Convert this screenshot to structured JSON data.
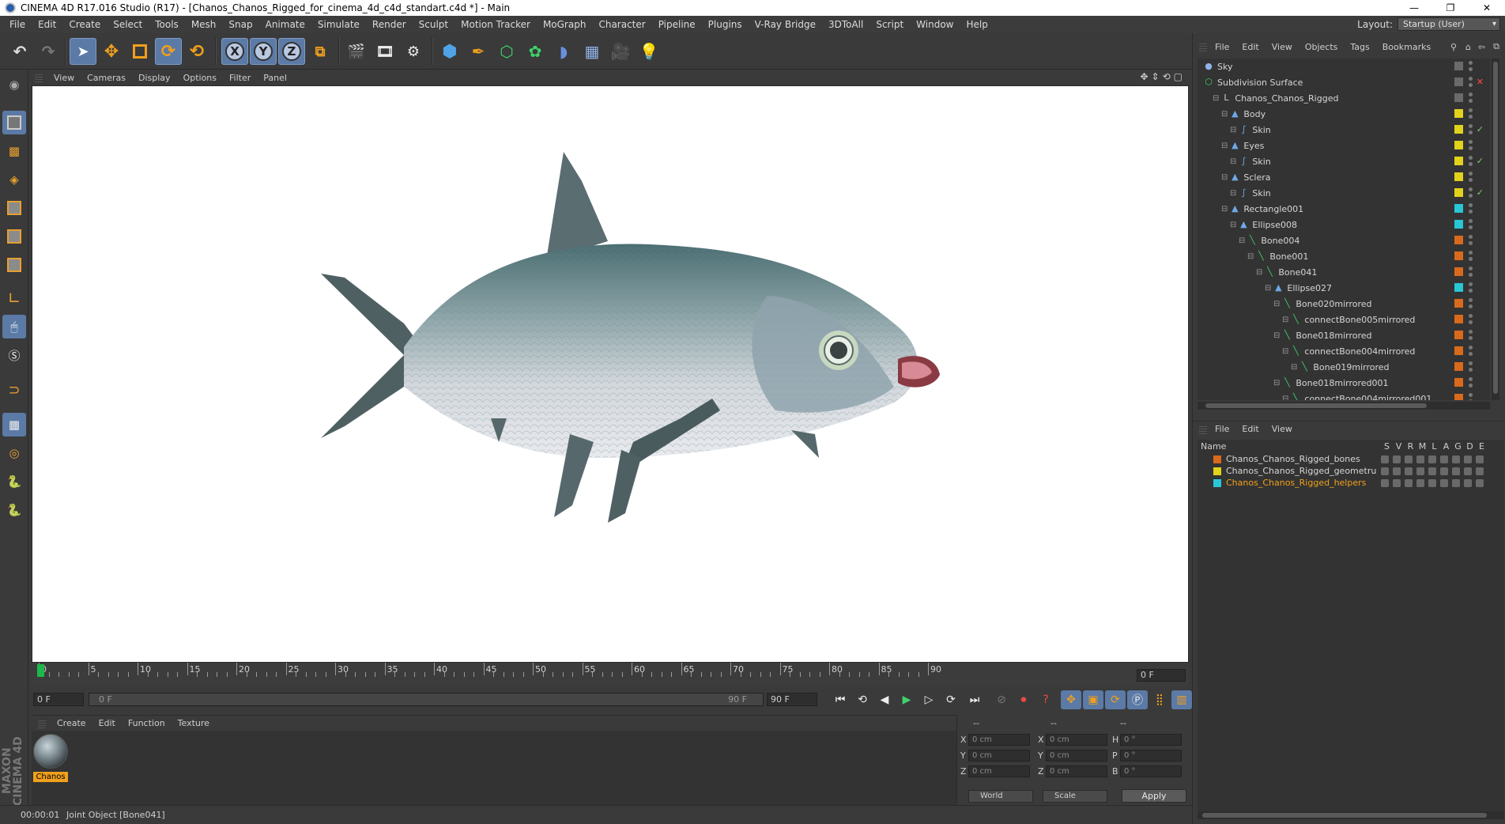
{
  "window": {
    "title": "CINEMA 4D R17.016 Studio (R17) - [Chanos_Chanos_Rigged_for_cinema_4d_c4d_standart.c4d *] - Main",
    "controls": [
      "—",
      "❐",
      "✕"
    ]
  },
  "menubar": {
    "items": [
      "File",
      "Edit",
      "Create",
      "Select",
      "Tools",
      "Mesh",
      "Snap",
      "Animate",
      "Simulate",
      "Render",
      "Sculpt",
      "Motion Tracker",
      "MoGraph",
      "Character",
      "Pipeline",
      "Plugins",
      "V-Ray Bridge",
      "3DToAll",
      "Script",
      "Window",
      "Help"
    ],
    "layout_label": "Layout:",
    "layout_value": "Startup (User)"
  },
  "toolbar": {
    "icons": [
      "undo-icon",
      "redo-icon",
      "select-arrow-icon",
      "move-icon",
      "scale-icon",
      "rotate-icon",
      "live-rotate-icon",
      "x-axis-icon",
      "y-axis-icon",
      "z-axis-icon",
      "coord-system-icon",
      "render-view-icon",
      "render-picture-viewer-icon",
      "render-settings-icon",
      "cube-icon",
      "pen-spline-icon",
      "subdivision-icon",
      "cloner-icon",
      "deformer-icon",
      "floor-icon",
      "camera-icon",
      "light-icon"
    ],
    "axis_labels": [
      "X",
      "Y",
      "Z"
    ]
  },
  "viewport": {
    "menu": [
      "View",
      "Cameras",
      "Display",
      "Options",
      "Filter",
      "Panel"
    ]
  },
  "timeline": {
    "ticks": [
      0,
      5,
      10,
      15,
      20,
      25,
      30,
      35,
      40,
      45,
      50,
      55,
      60,
      65,
      70,
      75,
      80,
      85,
      90
    ],
    "current_frame": 0,
    "end_frame_field": "0 F"
  },
  "transport": {
    "start_field": "0 F",
    "range_start": "0 F",
    "range_end": "90 F",
    "end_field": "90 F"
  },
  "material_manager": {
    "menu": [
      "Create",
      "Edit",
      "Function",
      "Texture"
    ],
    "material_name": "Chanos"
  },
  "coordinates": {
    "header": [
      "--",
      "--",
      "--"
    ],
    "rows": [
      {
        "l1": "X",
        "v1": "0 cm",
        "l2": "X",
        "v2": "0 cm",
        "l3": "H",
        "v3": "0 °"
      },
      {
        "l1": "Y",
        "v1": "0 cm",
        "l2": "Y",
        "v2": "0 cm",
        "l3": "P",
        "v3": "0 °"
      },
      {
        "l1": "Z",
        "v1": "0 cm",
        "l2": "Z",
        "v2": "0 cm",
        "l3": "B",
        "v3": "0 °"
      }
    ],
    "space": "World",
    "mode": "Scale",
    "apply": "Apply"
  },
  "statusbar": {
    "time": "00:00:01",
    "message": "Joint Object [Bone041]"
  },
  "object_manager": {
    "menu": [
      "File",
      "Edit",
      "View",
      "Objects",
      "Tags",
      "Bookmarks"
    ],
    "items": [
      {
        "name": "Sky",
        "depth": 0,
        "icon": "sky-icon",
        "color": "",
        "extra": ""
      },
      {
        "name": "Subdivision Surface",
        "depth": 0,
        "icon": "subdivision-icon",
        "color": "",
        "extra": "x"
      },
      {
        "name": "Chanos_Chanos_Rigged",
        "depth": 1,
        "icon": "null-icon",
        "color": "",
        "extra": ""
      },
      {
        "name": "Body",
        "depth": 2,
        "icon": "polygon-icon",
        "color": "#e2d21c",
        "extra": ""
      },
      {
        "name": "Skin",
        "depth": 3,
        "icon": "skin-icon",
        "color": "#e2d21c",
        "extra": "check"
      },
      {
        "name": "Eyes",
        "depth": 2,
        "icon": "polygon-icon",
        "color": "#e2d21c",
        "extra": ""
      },
      {
        "name": "Skin",
        "depth": 3,
        "icon": "skin-icon",
        "color": "#e2d21c",
        "extra": "check"
      },
      {
        "name": "Sclera",
        "depth": 2,
        "icon": "polygon-icon",
        "color": "#e2d21c",
        "extra": ""
      },
      {
        "name": "Skin",
        "depth": 3,
        "icon": "skin-icon",
        "color": "#e2d21c",
        "extra": "check"
      },
      {
        "name": "Rectangle001",
        "depth": 2,
        "icon": "spline-icon",
        "color": "#29c6d6",
        "extra": ""
      },
      {
        "name": "Ellipse008",
        "depth": 3,
        "icon": "spline-icon",
        "color": "#29c6d6",
        "extra": ""
      },
      {
        "name": "Bone004",
        "depth": 4,
        "icon": "joint-icon",
        "color": "#d96a1c",
        "extra": ""
      },
      {
        "name": "Bone001",
        "depth": 5,
        "icon": "joint-icon",
        "color": "#d96a1c",
        "extra": ""
      },
      {
        "name": "Bone041",
        "depth": 6,
        "icon": "joint-icon",
        "color": "#d96a1c",
        "extra": ""
      },
      {
        "name": "Ellipse027",
        "depth": 7,
        "icon": "spline-icon",
        "color": "#29c6d6",
        "extra": ""
      },
      {
        "name": "Bone020mirrored",
        "depth": 8,
        "icon": "joint-icon",
        "color": "#d96a1c",
        "extra": ""
      },
      {
        "name": "connectBone005mirrored",
        "depth": 9,
        "icon": "joint-icon",
        "color": "#d96a1c",
        "extra": ""
      },
      {
        "name": "Bone018mirrored",
        "depth": 8,
        "icon": "joint-icon",
        "color": "#d96a1c",
        "extra": ""
      },
      {
        "name": "connectBone004mirrored",
        "depth": 9,
        "icon": "joint-icon",
        "color": "#d96a1c",
        "extra": ""
      },
      {
        "name": "Bone019mirrored",
        "depth": 10,
        "icon": "joint-icon",
        "color": "#d96a1c",
        "extra": ""
      },
      {
        "name": "Bone018mirrored001",
        "depth": 8,
        "icon": "joint-icon",
        "color": "#d96a1c",
        "extra": ""
      },
      {
        "name": "connectBone004mirrored001",
        "depth": 9,
        "icon": "joint-icon",
        "color": "#d96a1c",
        "extra": ""
      }
    ]
  },
  "layer_manager": {
    "menu": [
      "File",
      "Edit",
      "View"
    ],
    "header": {
      "name": "Name",
      "flags": [
        "S",
        "V",
        "R",
        "M",
        "L",
        "A",
        "G",
        "D",
        "E"
      ]
    },
    "layers": [
      {
        "name": "Chanos_Chanos_Rigged_bones",
        "color": "#d96a1c",
        "selected": false
      },
      {
        "name": "Chanos_Chanos_Rigged_geometru",
        "color": "#e2d21c",
        "selected": false
      },
      {
        "name": "Chanos_Chanos_Rigged_helpers",
        "color": "#29c6d6",
        "selected": true
      }
    ]
  },
  "colors": {
    "accent": "#5b7aa6",
    "selected_text": "#f0a01c",
    "playhead": "#1db84a"
  }
}
